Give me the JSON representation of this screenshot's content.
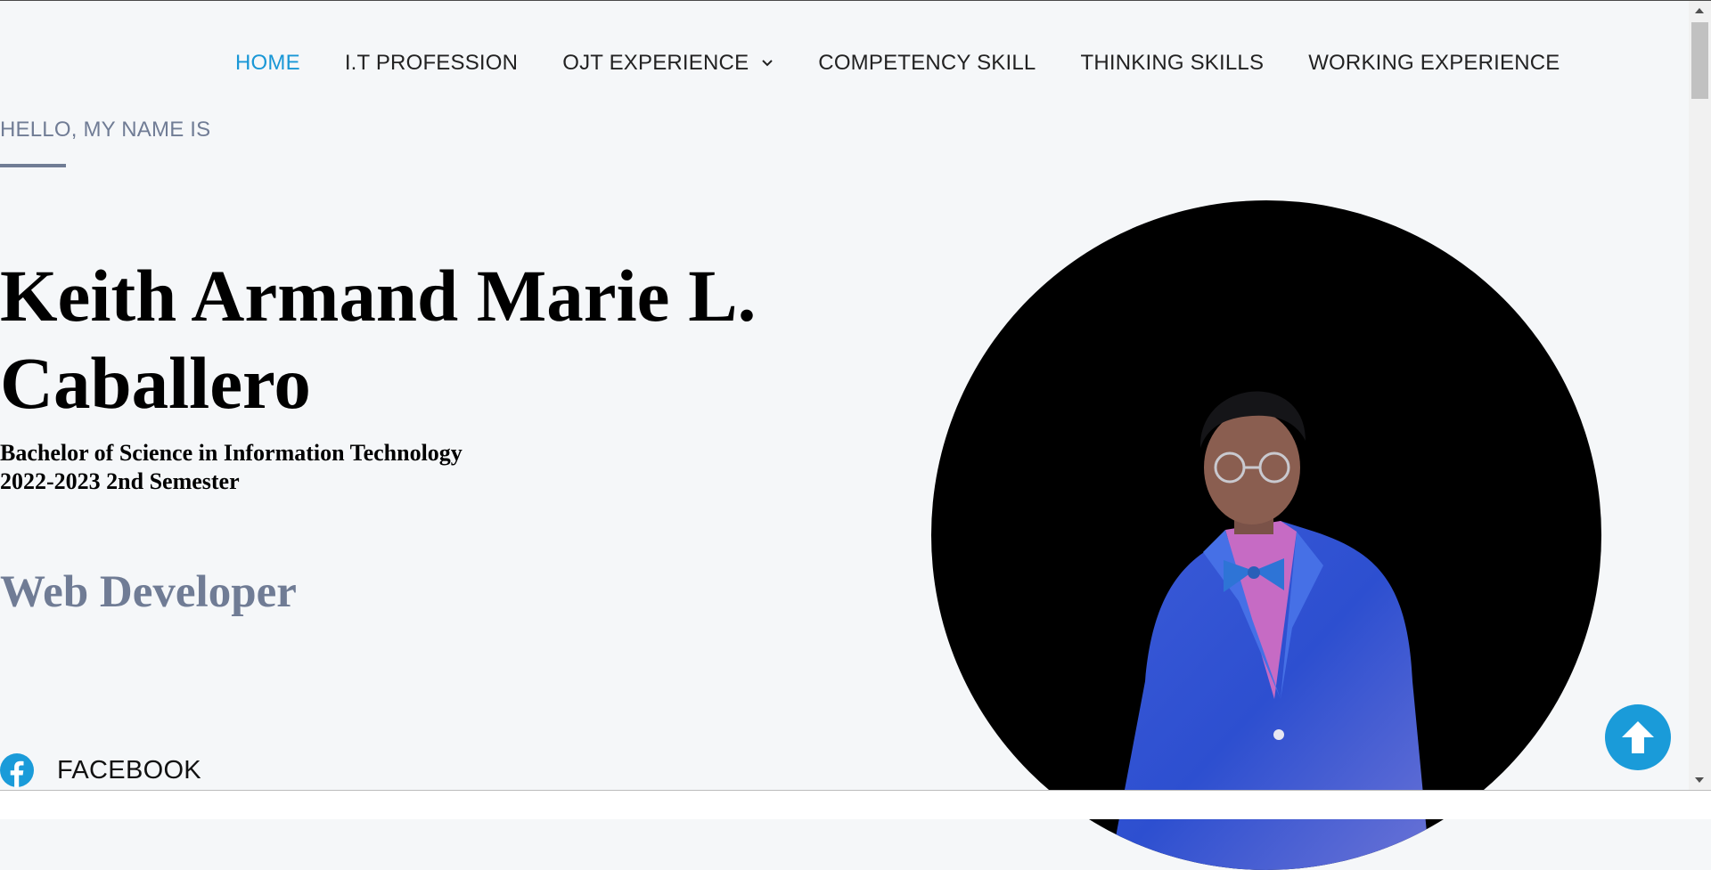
{
  "nav": {
    "items": [
      {
        "label": "HOME",
        "active": true
      },
      {
        "label": "I.T PROFESSION"
      },
      {
        "label": "OJT EXPERIENCE",
        "has_dropdown": true
      },
      {
        "label": "COMPETENCY SKILL"
      },
      {
        "label": "THINKING SKILLS"
      },
      {
        "label": "WORKING EXPERIENCE"
      }
    ]
  },
  "hero": {
    "greeting": "HELLO, MY NAME IS",
    "name_line1": "Keith Armand Marie L.",
    "name_line2": "Caballero",
    "degree": "Bachelor of Science in Information Technology",
    "term": "2022-2023 2nd Semester",
    "role": "Web Developer"
  },
  "social": {
    "facebook_label": "FACEBOOK",
    "icon": "facebook-icon"
  },
  "back_to_top": {
    "icon": "arrow-up-icon"
  },
  "colors": {
    "accent": "#1997d6",
    "muted": "#707c95",
    "background": "#f5f7f9"
  }
}
